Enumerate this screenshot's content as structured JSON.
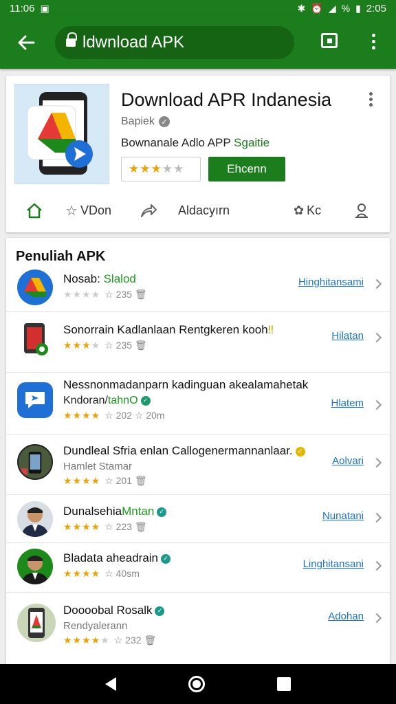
{
  "status_bar": {
    "time_left": "11:06",
    "time_right": "2:05",
    "battery": "%"
  },
  "browser": {
    "url": "ldwnload APK"
  },
  "app": {
    "title": "Download APR Indanesia",
    "developer": "Bapiek",
    "subtitle_plain": "Bownanale Adlo APP ",
    "subtitle_accent": "Sgaitie",
    "rating_stars": "★★★",
    "rating_dim": "★★",
    "install_label": "Ehcenn",
    "actions": [
      {
        "icon": "home-icon",
        "label": ""
      },
      {
        "icon": "star-outline-icon",
        "label": "VDon"
      },
      {
        "icon": "share-icon",
        "label": ""
      },
      {
        "icon": "",
        "label": "Aldacyırn"
      },
      {
        "icon": "puzzle-icon",
        "label": "Kc"
      },
      {
        "icon": "person-icon",
        "label": ""
      }
    ],
    "colors": {
      "brand": "#1b7d1b",
      "link": "#1a73c8",
      "star": "#f0a000"
    }
  },
  "list": {
    "title": "Penuliah APK",
    "items": [
      {
        "name": "Nosab: ",
        "name_accent": "Slalod",
        "sub": "",
        "stars": "★★★★",
        "stars_dim": "",
        "meta": "☆ 235 🗑",
        "link": "Hinghitansami",
        "icon": "drive-icon",
        "badge": ""
      },
      {
        "name": "Sonorrain Kadlanlaan Rentgkeren kooh",
        "name_accent": "‼",
        "sub": "",
        "stars": "★★★",
        "stars_dim": "★",
        "meta": "☆ 235 🗑",
        "link": "Hilatan",
        "icon": "app-red-icon",
        "badge": ""
      },
      {
        "name": "Nessnonmadanparn kadinguan akealamahetak",
        "name_accent": "",
        "sub": "Kndoran/",
        "sub_accent": "tahnO",
        "stars": "★★★★",
        "stars_dim": "",
        "meta": "☆ 202 ☆ 20m",
        "link": "Hlatem",
        "icon": "chat-icon",
        "badge": "green"
      },
      {
        "name": "Dundleal Sfria enlan Callogenermannanlaar.",
        "name_accent": "",
        "sub": "Hamlet Stamar",
        "stars": "★★★★",
        "stars_dim": "",
        "meta": "☆ 201 🗑",
        "link": "Aolvari",
        "icon": "phone-photo-icon",
        "badge": "yellow"
      },
      {
        "name": "Dunalsehia",
        "name_accent": "Mntan",
        "sub": "",
        "stars": "★★★★",
        "stars_dim": "",
        "meta": "☆ 223 🗑",
        "link": "Nunatani",
        "icon": "person-photo-icon",
        "badge": "teal"
      },
      {
        "name": "Bladata aheadrain",
        "name_accent": "",
        "sub": "",
        "stars": "★★★★",
        "stars_dim": "",
        "meta": "☆ 40sm",
        "link": "Linghitansani",
        "icon": "person-photo-green-icon",
        "badge": "teal"
      },
      {
        "name": "Doooobal Rosalk",
        "name_accent": "",
        "sub": "Rendyalerann",
        "stars": "★★★★",
        "stars_dim": "★",
        "meta": "☆ 232 🗑",
        "link": "Adohan",
        "icon": "drive-phone-icon",
        "badge": "teal"
      }
    ]
  }
}
